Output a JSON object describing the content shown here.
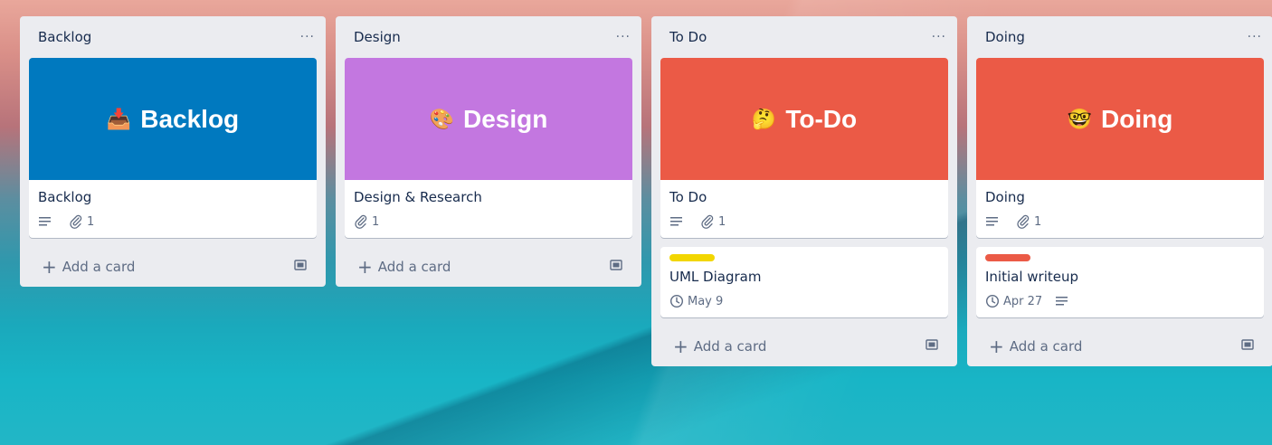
{
  "lists": [
    {
      "title": "Backlog",
      "menu": "···",
      "card": {
        "cover_emoji": "📥",
        "cover_text": "Backlog",
        "cover_color": "#0079bf",
        "title": "Backlog",
        "attachments": "1"
      },
      "add_label": "Add a card"
    },
    {
      "title": "Design",
      "menu": "···",
      "card": {
        "cover_emoji": "🎨",
        "cover_text": "Design",
        "cover_color": "#c377e0",
        "title": "Design & Research",
        "attachments": "1"
      },
      "add_label": "Add a card"
    },
    {
      "title": "To Do",
      "menu": "···",
      "card": {
        "cover_emoji": "🤔",
        "cover_text": "To-Do",
        "cover_color": "#eb5a46",
        "title": "To Do",
        "attachments": "1"
      },
      "card2": {
        "label_color": "#f2d600",
        "title": "UML Diagram",
        "due": "May 9"
      },
      "add_label": "Add a card"
    },
    {
      "title": "Doing",
      "menu": "···",
      "card": {
        "cover_emoji": "🤓",
        "cover_text": "Doing",
        "cover_color": "#eb5a46",
        "title": "Doing",
        "attachments": "1"
      },
      "card2": {
        "label_color": "#eb5a46",
        "title": "Initial writeup",
        "due": "Apr 27"
      },
      "add_label": "Add a card"
    }
  ],
  "icons": [
    "description-icon",
    "paperclip-icon",
    "clock-icon",
    "plus-icon",
    "card-template-icon"
  ]
}
